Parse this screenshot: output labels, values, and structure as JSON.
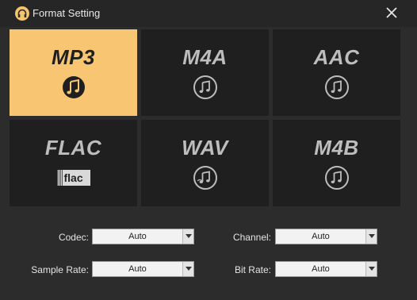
{
  "window": {
    "title": "Format Setting",
    "app_icon": "headphones-icon",
    "close_icon": "close-icon"
  },
  "formats": [
    {
      "label": "MP3",
      "icon": "music-note-icon",
      "selected": true
    },
    {
      "label": "M4A",
      "icon": "music-note-icon",
      "selected": false
    },
    {
      "label": "AAC",
      "icon": "music-note-icon",
      "selected": false
    },
    {
      "label": "FLAC",
      "icon": "flac-icon",
      "icon_text": "flac",
      "selected": false
    },
    {
      "label": "WAV",
      "icon": "music-note-icon",
      "selected": false
    },
    {
      "label": "M4B",
      "icon": "music-note-icon",
      "selected": false
    }
  ],
  "settings": {
    "codec": {
      "label": "Codec:",
      "value": "Auto"
    },
    "channel": {
      "label": "Channel:",
      "value": "Auto"
    },
    "sample_rate": {
      "label": "Sample Rate:",
      "value": "Auto"
    },
    "bit_rate": {
      "label": "Bit Rate:",
      "value": "Auto"
    }
  },
  "colors": {
    "accent": "#f8c573",
    "tile_bg": "#1f1f1f",
    "window_bg": "#2c2c2c"
  }
}
